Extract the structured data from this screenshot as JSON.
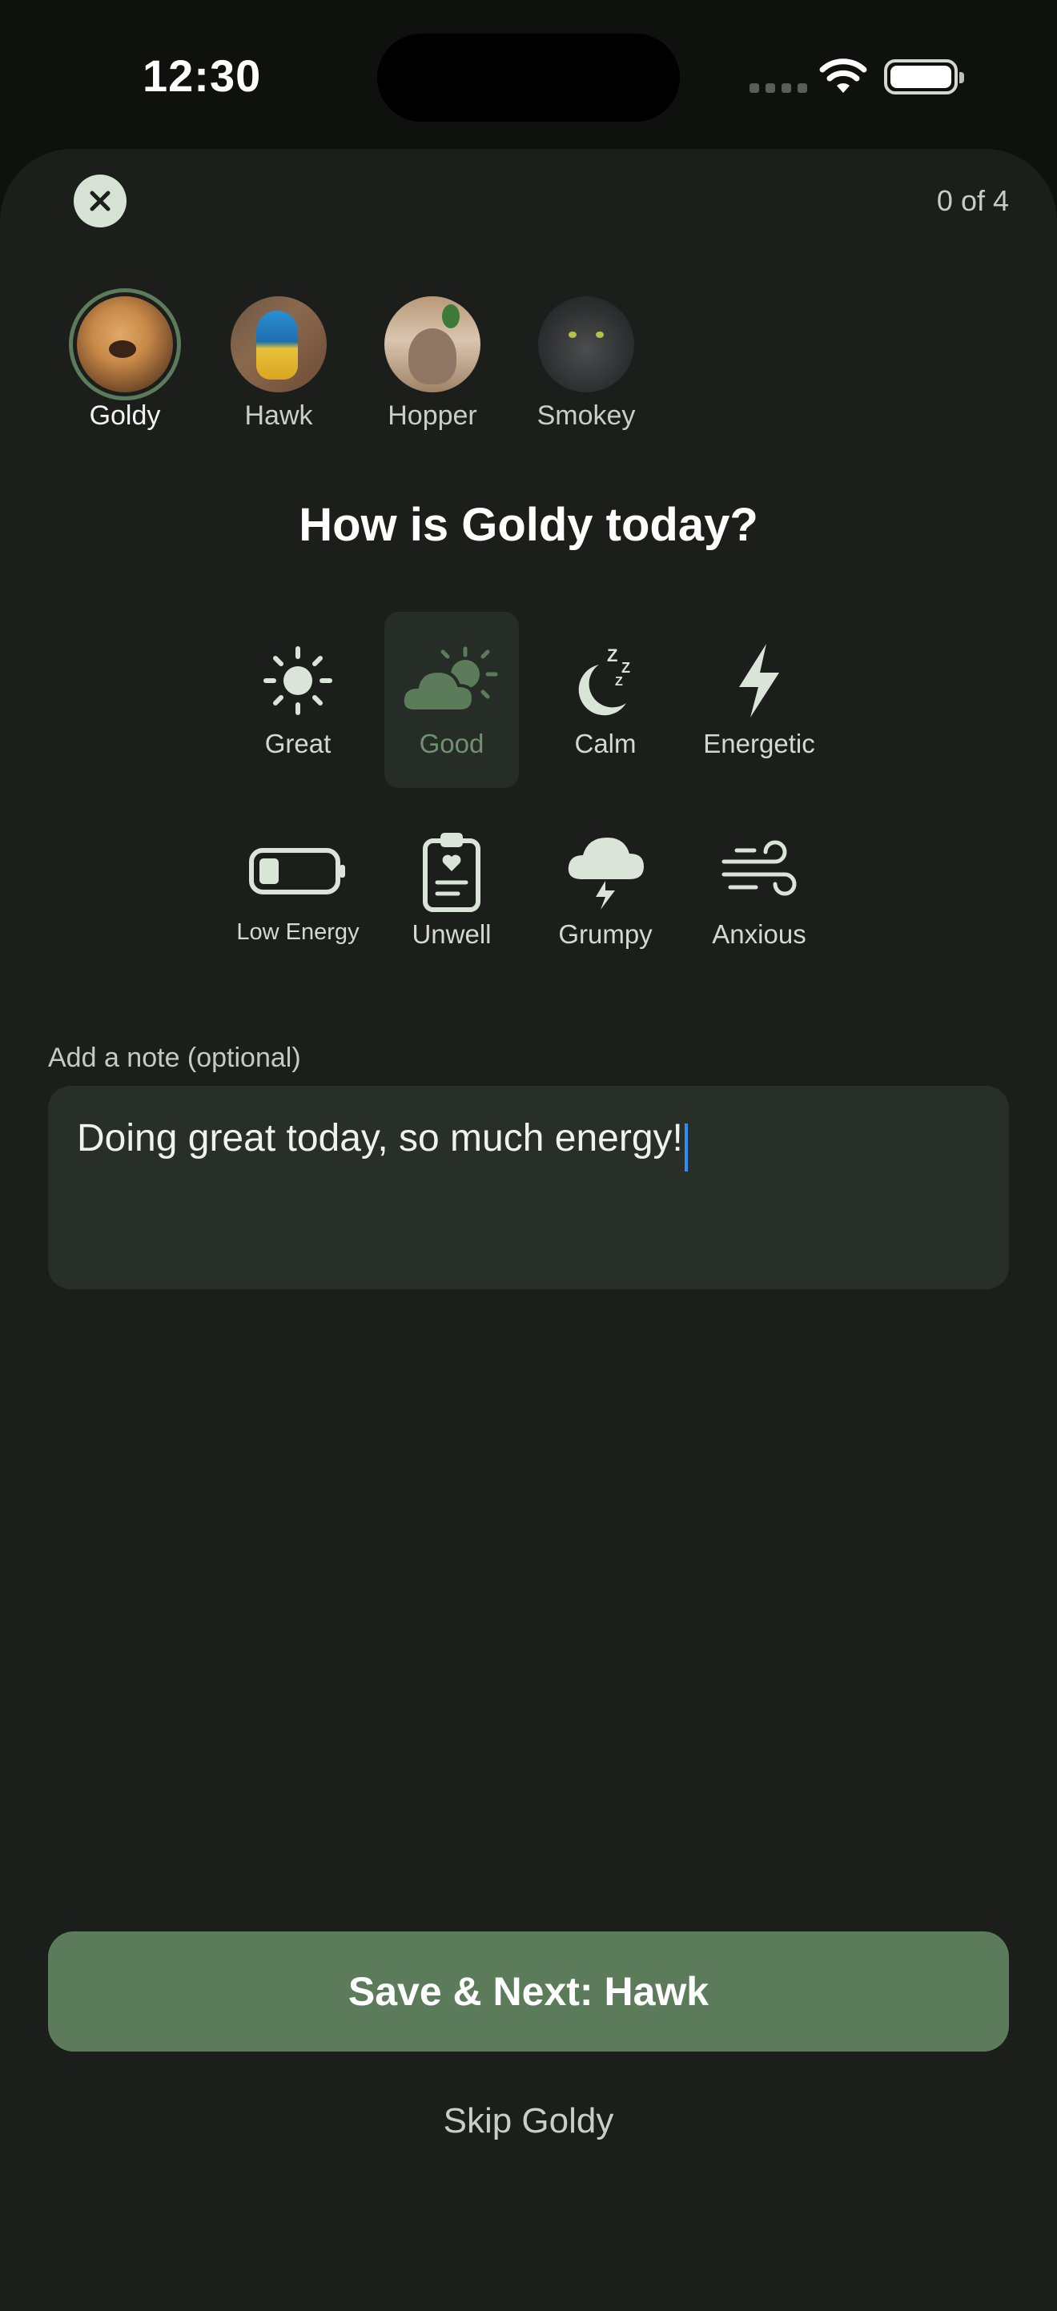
{
  "status": {
    "time": "12:30"
  },
  "header": {
    "progress": "0 of 4"
  },
  "pets": [
    {
      "name": "Goldy",
      "selected": true
    },
    {
      "name": "Hawk",
      "selected": false
    },
    {
      "name": "Hopper",
      "selected": false
    },
    {
      "name": "Smokey",
      "selected": false
    }
  ],
  "question": "How is Goldy today?",
  "moods": [
    {
      "label": "Great",
      "icon": "sun-icon",
      "selected": false
    },
    {
      "label": "Good",
      "icon": "partly-cloudy-icon",
      "selected": true
    },
    {
      "label": "Calm",
      "icon": "moon-sleep-icon",
      "selected": false
    },
    {
      "label": "Energetic",
      "icon": "lightning-icon",
      "selected": false
    },
    {
      "label": "Low Energy",
      "icon": "battery-low-icon",
      "selected": false
    },
    {
      "label": "Unwell",
      "icon": "clipboard-heart-icon",
      "selected": false
    },
    {
      "label": "Grumpy",
      "icon": "storm-cloud-icon",
      "selected": false
    },
    {
      "label": "Anxious",
      "icon": "wind-icon",
      "selected": false
    }
  ],
  "note": {
    "label": "Add a note (optional)",
    "value": "Doing great today, so much energy!"
  },
  "actions": {
    "save_label": "Save & Next: Hawk",
    "skip_label": "Skip Goldy"
  },
  "colors": {
    "accent": "#5c7b5b",
    "background": "#1b1e1b",
    "field": "#282e28"
  }
}
